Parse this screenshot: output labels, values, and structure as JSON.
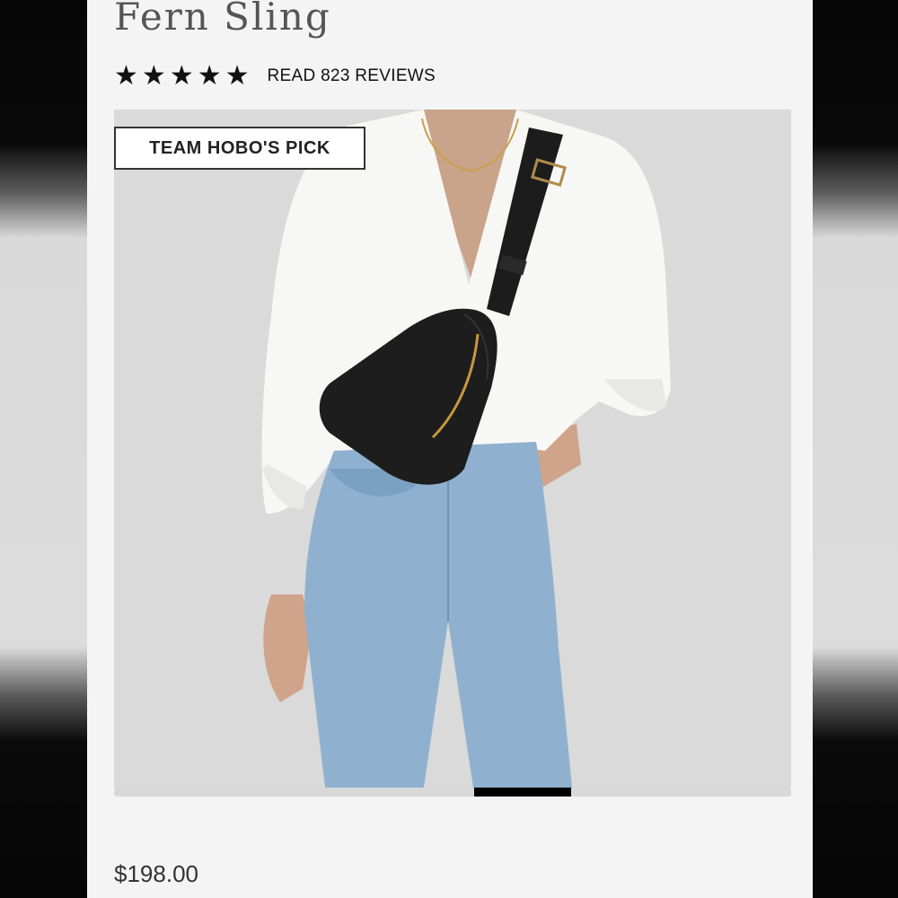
{
  "product": {
    "title": "Fern Sling",
    "rating": {
      "stars": 5,
      "max": 5,
      "star_glyph": "★",
      "reviews_label": "READ 823 REVIEWS"
    },
    "badge": "TEAM HOBO'S PICK",
    "image": {
      "icon": "product-photo",
      "alt": "Woman wearing black leather Fern Sling bag across white blouse and blue jeans"
    },
    "gallery": {
      "scroll_position": 0.62
    },
    "price": "$198.00"
  }
}
